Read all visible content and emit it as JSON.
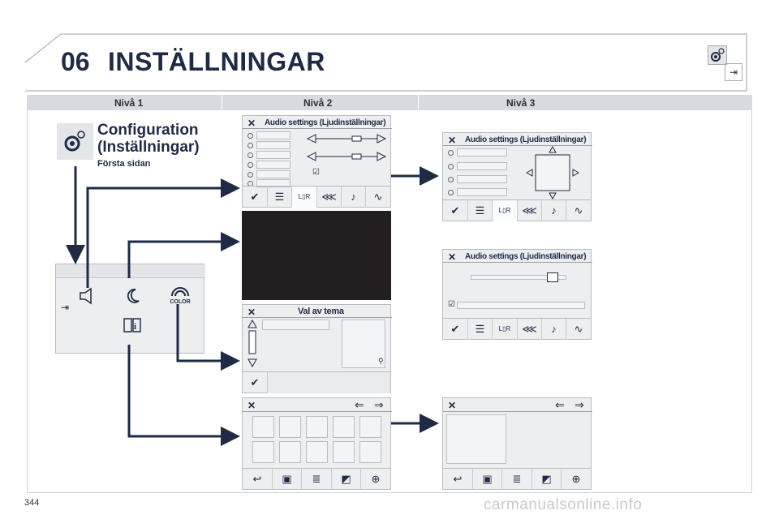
{
  "header": {
    "chapter": "06",
    "title": "INSTÄLLNINGAR"
  },
  "levels": {
    "l1": "Nivå 1",
    "l2": "Nivå 2",
    "l3": "Nivå 3"
  },
  "config": {
    "title_line1": "Configuration",
    "title_line2": "(Inställningar)",
    "subtitle": "Första sidan"
  },
  "panels": {
    "audio_title": "Audio settings (Ljudinställningar)",
    "theme_title": "Val av tema",
    "color_label": "COLOR"
  },
  "toolbar_icons": [
    "check-icon",
    "equalizer-icon",
    "balance-icon",
    "sound-ambience-icon",
    "music-note-icon",
    "voice-icon"
  ],
  "footer": {
    "page_number": "344",
    "watermark": "carmanualsonline.info"
  },
  "colors": {
    "navy": "#1f2a44",
    "panel_bg": "#eceef0",
    "level_bar": "#d7dadf"
  }
}
